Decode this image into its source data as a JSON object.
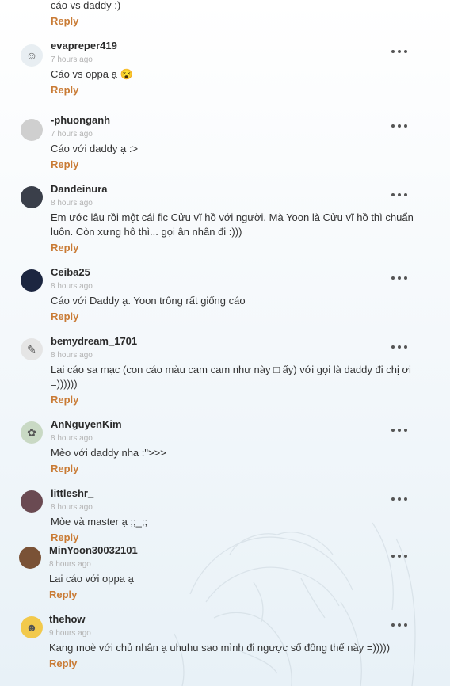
{
  "top_partial": {
    "text": "cáo vs daddy :)",
    "reply_label": "Reply"
  },
  "comments": [
    {
      "username": "evapreper419",
      "time": "7 hours ago",
      "text": "Cáo vs oppa ạ 😵",
      "reply_label": "Reply",
      "avatar_icon": "cartoon-face-icon",
      "avatar_color": "#e8eef2"
    },
    {
      "username": "-phuonganh",
      "time": "7 hours ago",
      "text": "Cáo với daddy ạ :>",
      "reply_label": "Reply",
      "avatar_icon": "person-photo-icon",
      "avatar_color": "#cfcfcf"
    },
    {
      "username": "Dandeinura",
      "time": "8 hours ago",
      "text": "Em ước lâu rồi một cái fic Cửu vĩ hồ với người. Mà Yoon là Cửu vĩ hồ thì chuẩn luôn. Còn xưng hô thì... gọi ân nhân đi :)))",
      "reply_label": "Reply",
      "avatar_icon": "moon-photo-icon",
      "avatar_color": "#3a3f4a"
    },
    {
      "username": "Ceiba25",
      "time": "8 hours ago",
      "text": "Cáo với Daddy ạ. Yoon trông rất giống cáo",
      "reply_label": "Reply",
      "avatar_icon": "dark-photo-icon",
      "avatar_color": "#1c2640"
    },
    {
      "username": "bemydream_1701",
      "time": "8 hours ago",
      "text": "Lai cáo sa mạc (con cáo màu cam cam như này □ ấy) với gọi là daddy đi chị ơi =))))))",
      "reply_label": "Reply",
      "avatar_icon": "sketch-icon",
      "avatar_color": "#e5e5e5"
    },
    {
      "username": "AnNguyenKim",
      "time": "8 hours ago",
      "text": "Mèo với daddy nha :\">>>",
      "reply_label": "Reply",
      "avatar_icon": "green-character-icon",
      "avatar_color": "#c9d9c4"
    },
    {
      "username": "littleshr_",
      "time": "8 hours ago",
      "text": "Mòe và master ạ ;;_;;",
      "reply_label": "Reply",
      "avatar_icon": "portrait-photo-icon",
      "avatar_color": "#6a4a52"
    },
    {
      "username": "MinYoon30032101",
      "time": "8 hours ago",
      "text": "Lai cáo với oppa ạ",
      "reply_label": "Reply",
      "avatar_icon": "portrait-photo-icon",
      "avatar_color": "#7a5236"
    },
    {
      "username": "thehow",
      "time": "9 hours ago",
      "text": "Kang moè với chủ nhân ạ uhuhu sao mình đi ngược số đông thế này =)))))",
      "reply_label": "Reply",
      "avatar_icon": "cartoon-character-icon",
      "avatar_color": "#f2c94c"
    }
  ]
}
